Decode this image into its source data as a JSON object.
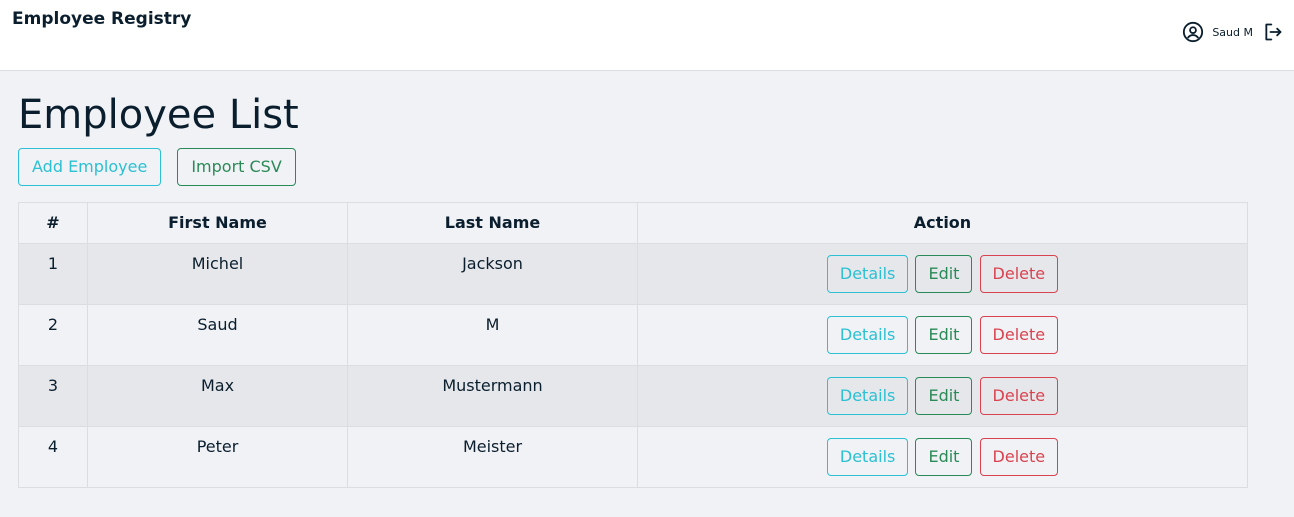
{
  "header": {
    "brand": "Employee Registry",
    "user_name": "Saud M"
  },
  "page": {
    "title": "Employee List",
    "add_button": "Add Employee",
    "import_button": "Import CSV"
  },
  "table": {
    "columns": [
      "#",
      "First Name",
      "Last Name",
      "Action"
    ],
    "rows": [
      {
        "num": "1",
        "first": "Michel",
        "last": "Jackson"
      },
      {
        "num": "2",
        "first": "Saud",
        "last": "M"
      },
      {
        "num": "3",
        "first": "Max",
        "last": "Mustermann"
      },
      {
        "num": "4",
        "first": "Peter",
        "last": "Meister"
      }
    ],
    "actions": {
      "details": "Details",
      "edit": "Edit",
      "delete": "Delete"
    }
  },
  "colors": {
    "info": "#2bc0d3",
    "success": "#2a8a57",
    "danger": "#d9434f"
  }
}
